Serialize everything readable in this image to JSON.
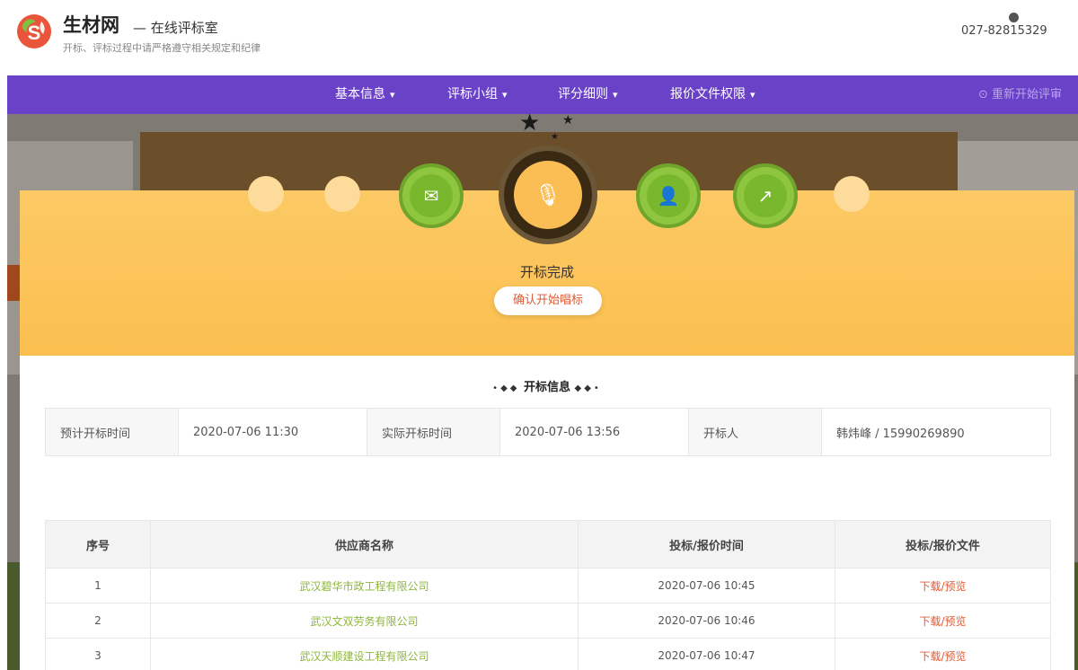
{
  "header": {
    "brand": "生材网",
    "subtitle": "— 在线评标室",
    "notice": "开标、评标过程中请严格遵守相关规定和纪律",
    "phone": "027-82815329"
  },
  "nav": {
    "items": [
      {
        "label": "基本信息"
      },
      {
        "label": "评标小组"
      },
      {
        "label": "评分细则"
      },
      {
        "label": "报价文件权限"
      }
    ],
    "restart": "⊙ 重新开始评审"
  },
  "banner": {
    "status": "开标完成",
    "confirm_button": "确认开始唱标"
  },
  "info": {
    "title": "开标信息",
    "planned_label": "预计开标时间",
    "planned_value": "2020-07-06 11:30",
    "actual_label": "实际开标时间",
    "actual_value": "2020-07-06 13:56",
    "opener_label": "开标人",
    "opener_value": "韩炜峰 / 15990269890"
  },
  "table": {
    "headers": [
      "序号",
      "供应商名称",
      "投标/报价时间",
      "投标/报价文件"
    ],
    "rows": [
      {
        "no": "1",
        "supplier": "武汉碧华市政工程有限公司",
        "time": "2020-07-06 10:45",
        "file": "下载/预览"
      },
      {
        "no": "2",
        "supplier": "武汉文双劳务有限公司",
        "time": "2020-07-06 10:46",
        "file": "下载/预览"
      },
      {
        "no": "3",
        "supplier": "武汉天顺建设工程有限公司",
        "time": "2020-07-06 10:47",
        "file": "下载/预览"
      }
    ]
  },
  "colors": {
    "nav": "#6a42c8",
    "banner": "#fbbf50",
    "green": "#8ec63f",
    "link": "#e05a34"
  },
  "icons": [
    "logo-icon",
    "phone-icon",
    "chevron-down-icon",
    "refresh-icon",
    "mail-icon",
    "microphone-icon",
    "user-icon",
    "chart-icon",
    "star-icon"
  ]
}
